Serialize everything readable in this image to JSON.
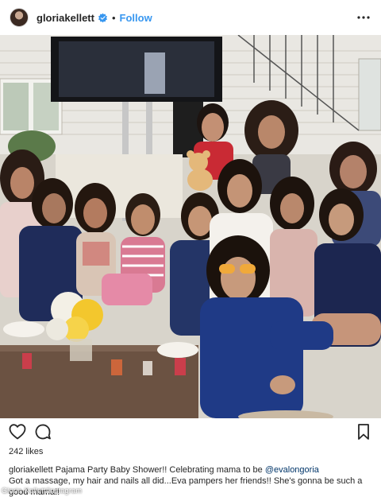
{
  "header": {
    "username": "gloriakellett",
    "separator": "•",
    "follow_label": "Follow"
  },
  "post": {
    "likes": "242 likes",
    "caption": {
      "username": "gloriakellett",
      "text_before_mention": "Pajama Party Baby Shower!! Celebrating mama to be",
      "mention": "@evalongoria",
      "text_after": "Got a massage, my hair and nails all did...Eva pampers her friends!! She's gonna be such a good mama!!"
    }
  },
  "credit": "Gloria Kellett/Instagram",
  "colors": {
    "accent": "#3897f0",
    "verified": "#3897f0",
    "text": "#262626",
    "mention": "#003569"
  },
  "icons": {
    "verified": "verified-badge-icon",
    "more": "more-options-icon",
    "like": "heart-icon",
    "comment": "comment-icon",
    "save": "bookmark-icon"
  }
}
